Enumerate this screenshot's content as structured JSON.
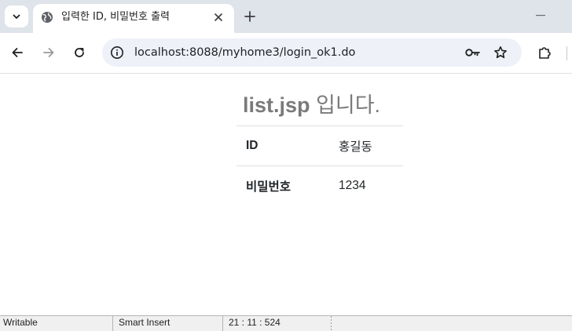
{
  "browser": {
    "tab": {
      "title": "입력한 ID, 비밀번호 출력"
    },
    "address_bar": {
      "url": "localhost:8088/myhome3/login_ok1.do"
    }
  },
  "page": {
    "heading_bold": "list.jsp",
    "heading_rest": " 입니다.",
    "rows": [
      {
        "key": "ID",
        "value": "홍길동"
      },
      {
        "key": "비밀번호",
        "value": "1234"
      }
    ]
  },
  "statusbar": {
    "mode": "Writable",
    "insert": "Smart Insert",
    "position": "21 : 11 : 524"
  },
  "colors": {
    "tabstrip": "#dfe3ea",
    "omnibox": "#eef1f8",
    "heading": "#7a7a7a"
  }
}
